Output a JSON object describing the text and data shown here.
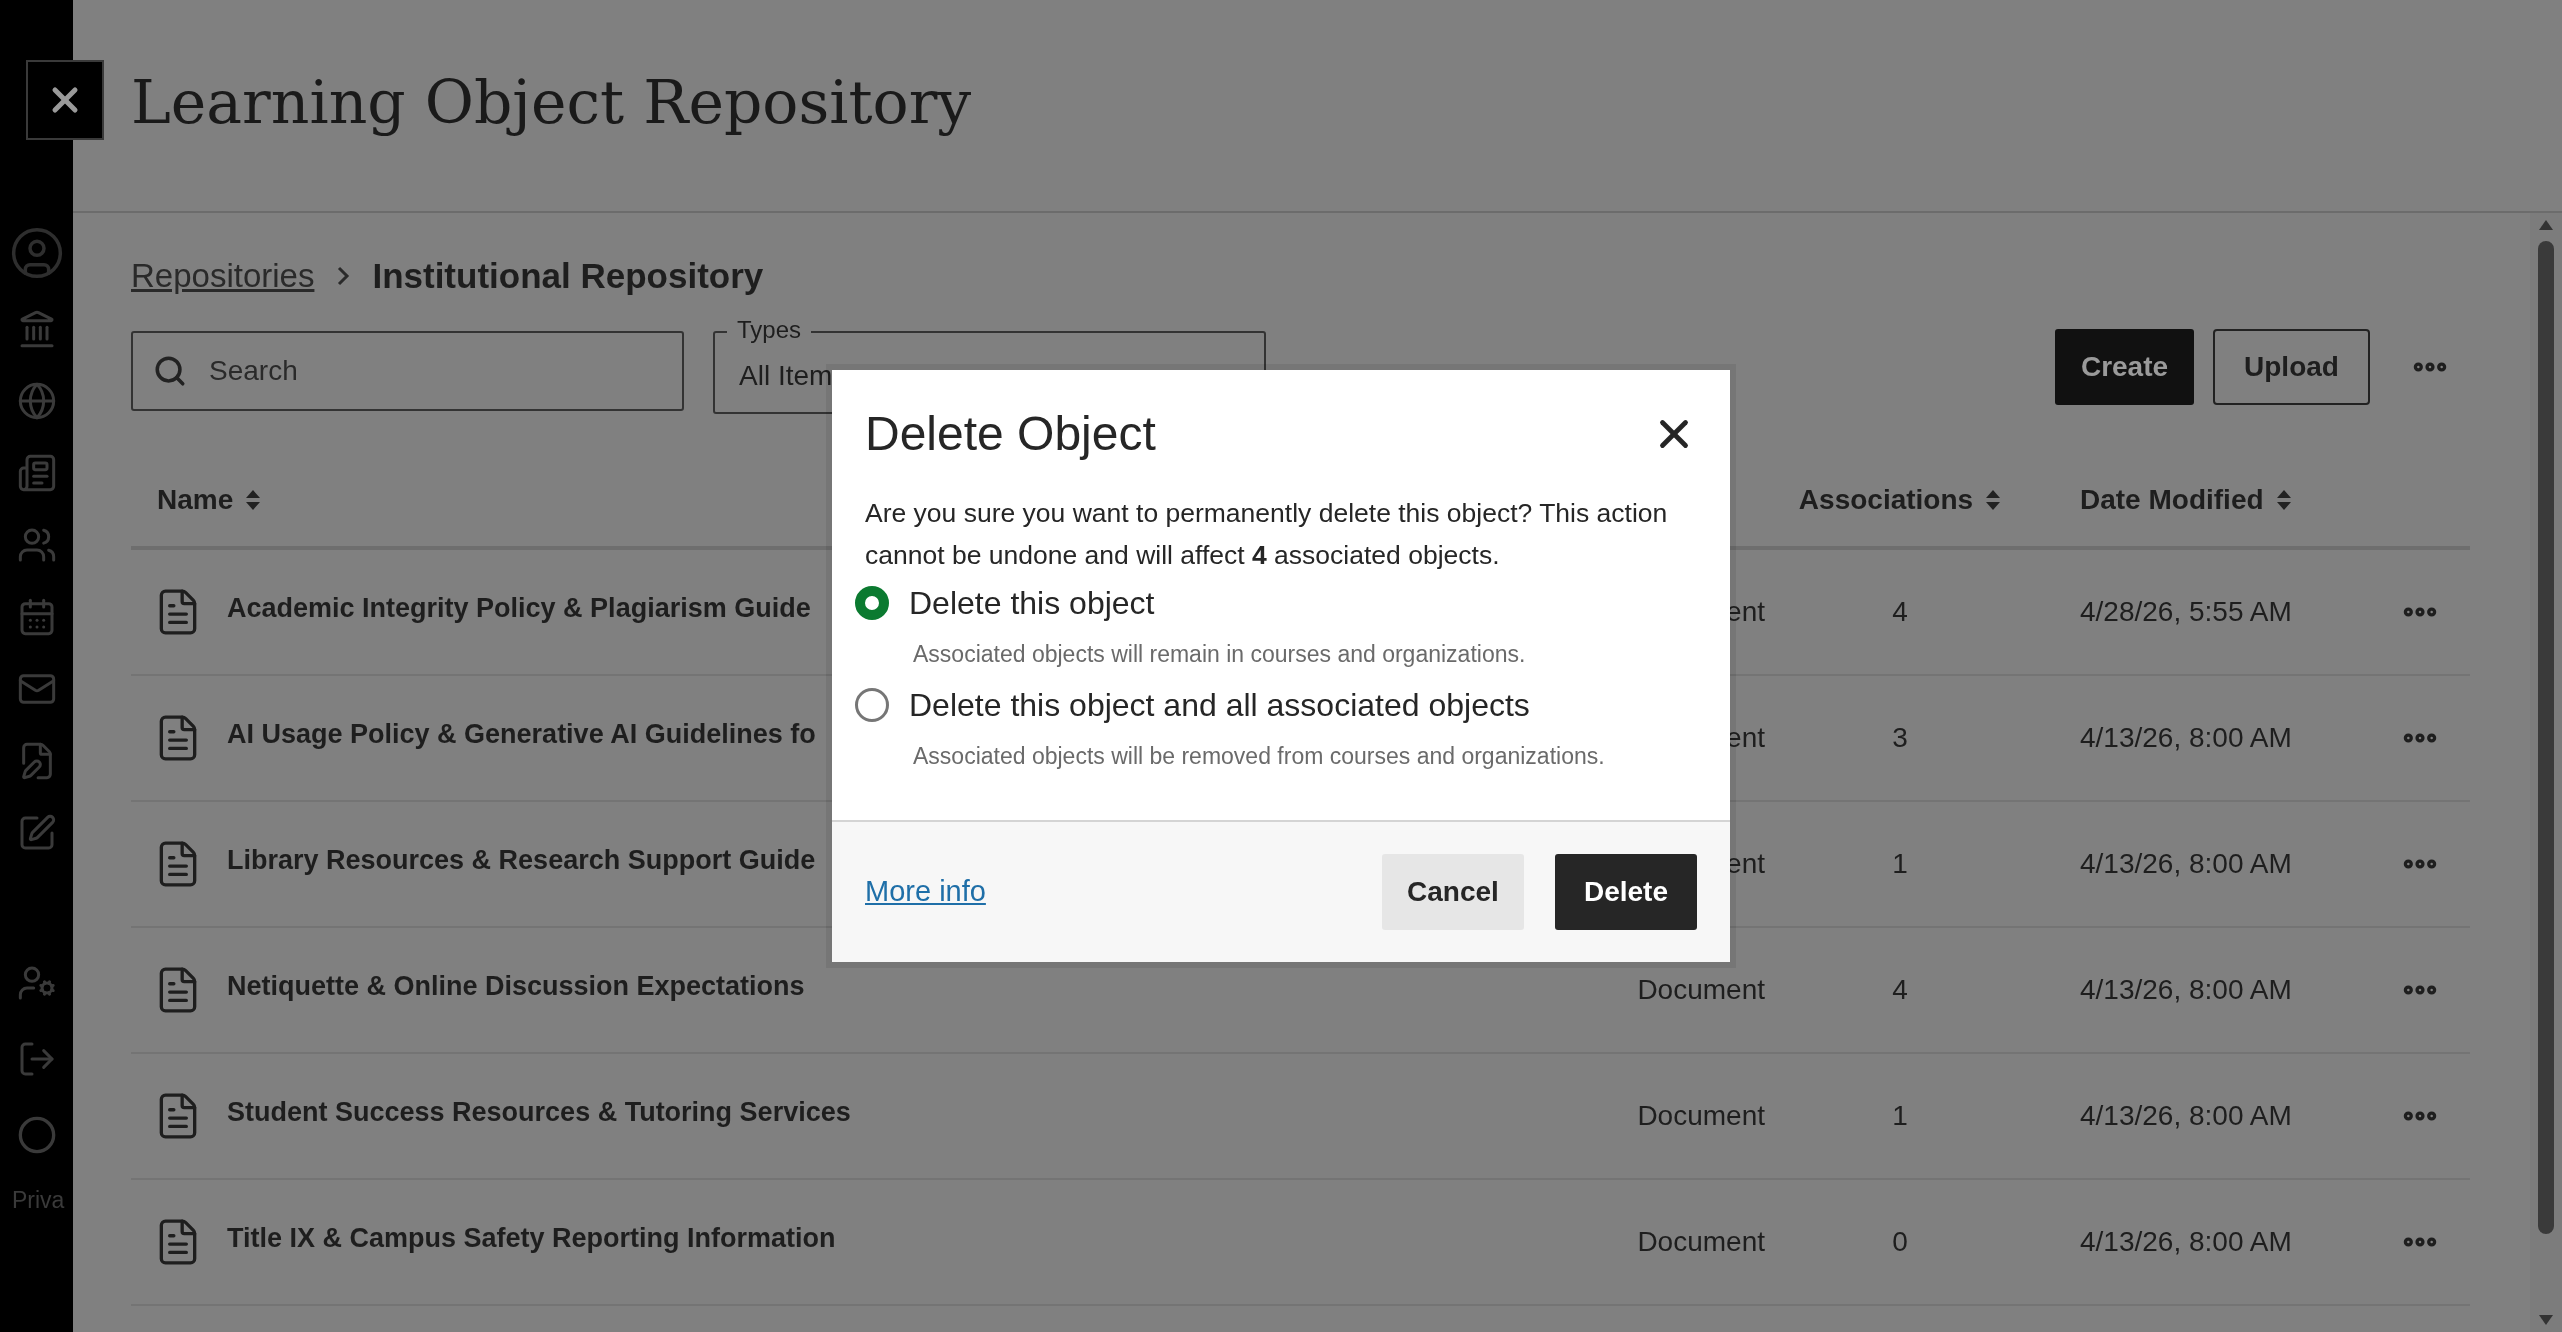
{
  "header": {
    "title": "Learning Object Repository"
  },
  "sidebar": {
    "footer_text": "Priva"
  },
  "breadcrumb": {
    "parent": "Repositories",
    "current": "Institutional Repository"
  },
  "search": {
    "placeholder": "Search"
  },
  "types_filter": {
    "label": "Types",
    "value": "All Item"
  },
  "actions": [
    "Create",
    "Upload"
  ],
  "table": {
    "columns": [
      "Name",
      "Associations",
      "Date Modified"
    ],
    "rows": [
      {
        "name": "Academic Integrity Policy & Plagiarism Guide",
        "type": "ent",
        "associations": "4",
        "date": "4/28/26, 5:55 AM"
      },
      {
        "name": "AI Usage Policy & Generative AI Guidelines fo",
        "type": "ent",
        "associations": "3",
        "date": "4/13/26, 8:00 AM"
      },
      {
        "name": "Library Resources & Research Support Guide",
        "type": "ent",
        "associations": "1",
        "date": "4/13/26, 8:00 AM"
      },
      {
        "name": "Netiquette & Online Discussion Expectations",
        "type": "Document",
        "associations": "4",
        "date": "4/13/26, 8:00 AM"
      },
      {
        "name": "Student Success Resources & Tutoring Services",
        "type": "Document",
        "associations": "1",
        "date": "4/13/26, 8:00 AM"
      },
      {
        "name": "Title IX & Campus Safety Reporting Information",
        "type": "Document",
        "associations": "0",
        "date": "4/13/26, 8:00 AM"
      }
    ]
  },
  "dialog": {
    "title": "Delete Object",
    "message": "Are you sure you want to permanently delete this object? This action cannot be undone and will affect **4** associated objects.",
    "options": [
      {
        "label": "Delete this object",
        "description": "Associated objects will remain in courses and organizations.",
        "selected": true
      },
      {
        "label": "Delete this object and all associated objects",
        "description": "Associated objects will be removed from courses and organizations.",
        "selected": false
      }
    ],
    "link": "More info",
    "buttons": [
      "Cancel",
      "Delete"
    ]
  }
}
